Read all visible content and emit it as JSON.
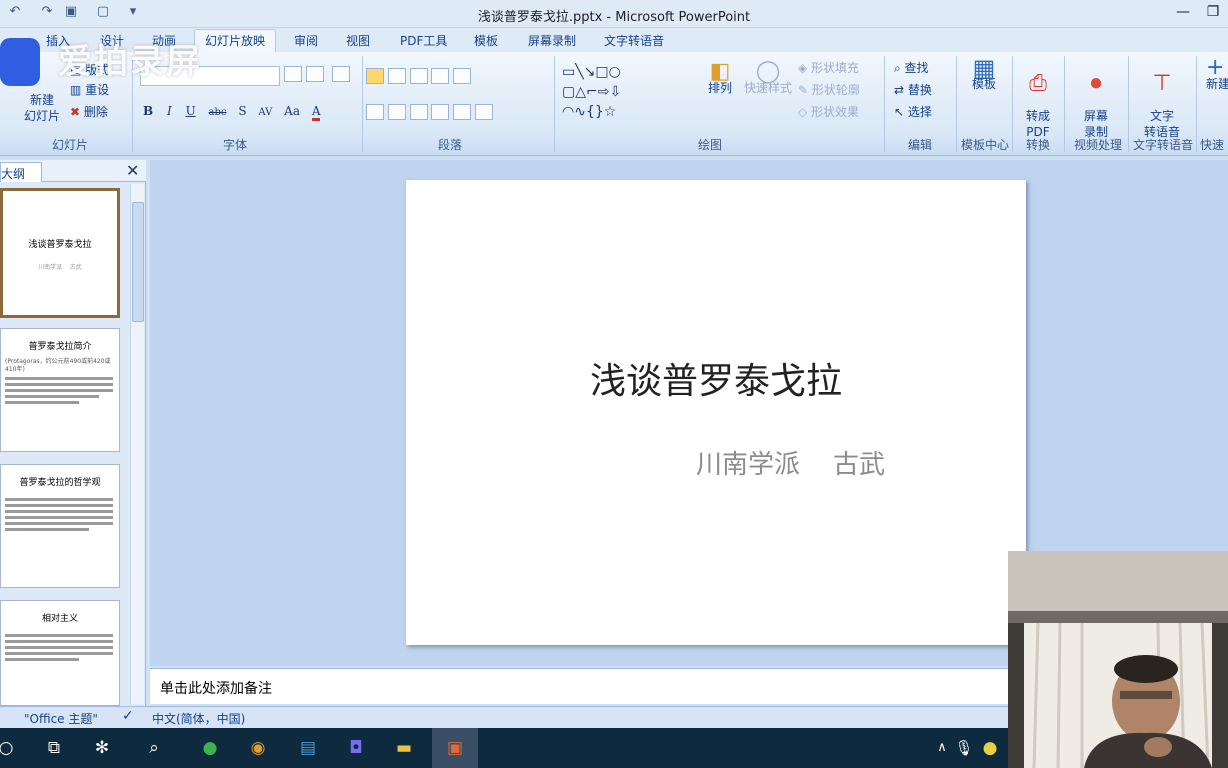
{
  "window": {
    "title": "浅谈普罗泰戈拉.pptx - Microsoft PowerPoint"
  },
  "watermark": {
    "text": "爱拍录屏"
  },
  "tabs": [
    {
      "label": "插入"
    },
    {
      "label": "设计"
    },
    {
      "label": "动画"
    },
    {
      "label": "幻灯片放映"
    },
    {
      "label": "审阅"
    },
    {
      "label": "视图"
    },
    {
      "label": "PDF工具"
    },
    {
      "label": "模板"
    },
    {
      "label": "屏幕录制"
    },
    {
      "label": "文字转语音"
    }
  ],
  "ribbon": {
    "slides_group": {
      "new_slide": "新建\n幻灯片",
      "layout": "版式",
      "reset": "重设",
      "delete": "删除",
      "label": "幻灯片"
    },
    "font_group": {
      "label": "字体",
      "buttons": [
        "B",
        "I",
        "U",
        "abc",
        "S",
        "AV",
        "Aa",
        "A"
      ]
    },
    "para_group": {
      "label": "段落"
    },
    "draw_group": {
      "label": "绘图",
      "arrange": "排列",
      "quick_styles": "快速样式",
      "shape_fill": "形状填充",
      "shape_outline": "形状轮廓",
      "shape_effects": "形状效果"
    },
    "edit_group": {
      "label": "编辑",
      "find": "查找",
      "replace": "替换",
      "select": "选择"
    },
    "template_group": {
      "button": "模板",
      "label": "模板中心"
    },
    "convert_group": {
      "button": "转成\nPDF",
      "label": "转换"
    },
    "video_group": {
      "button": "屏幕\n录制",
      "label": "视频处理"
    },
    "tts_group": {
      "button": "文字\n转语音",
      "label": "文字转语音"
    },
    "quick_group": {
      "button": "新建",
      "label": "快速"
    }
  },
  "outline_pane": {
    "tab": "大纲"
  },
  "thumbnails": [
    {
      "title": "浅谈普罗泰戈拉",
      "subtitle": "川南学派    古武"
    },
    {
      "title": "普罗泰戈拉简介",
      "text": "(Protagoras，约公元前490或前420或410年)"
    },
    {
      "title": "普罗泰戈拉的哲学观"
    },
    {
      "title": "相对主义"
    }
  ],
  "slide": {
    "title": "浅谈普罗泰戈拉",
    "subtitle": "川南学派    古武"
  },
  "notes": {
    "placeholder": "单击此处添加备注"
  },
  "status": {
    "theme": "\"Office 主题\"",
    "language": "中文(简体，中国)"
  }
}
